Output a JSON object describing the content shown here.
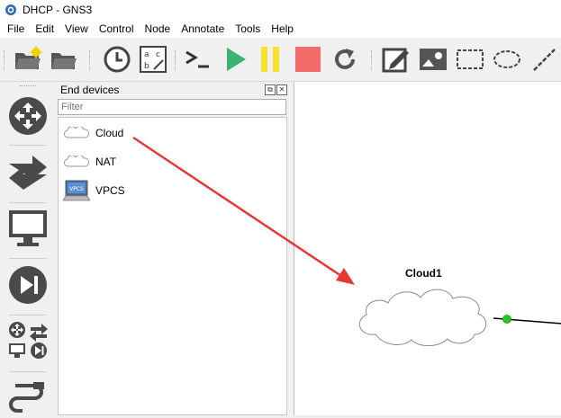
{
  "window": {
    "title": "DHCP - GNS3"
  },
  "menu": [
    "File",
    "Edit",
    "View",
    "Control",
    "Node",
    "Annotate",
    "Tools",
    "Help"
  ],
  "toolbar": {
    "icons": [
      "new-project-icon",
      "open-project-icon",
      "snapshot-icon",
      "device-labels-icon",
      "console-icon",
      "start-icon",
      "suspend-icon",
      "stop-icon",
      "reload-icon",
      "add-note-icon",
      "insert-image-icon",
      "draw-rectangle-icon",
      "draw-ellipse-icon",
      "draw-line-icon"
    ],
    "colors": {
      "start": "#3cb371",
      "suspend": "#f5e22a",
      "stop": "#f36a6a"
    }
  },
  "left_toolbar": [
    "routers-icon",
    "switches-icon",
    "end-devices-icon",
    "security-devices-icon",
    "all-devices-icon",
    "add-link-icon"
  ],
  "dock": {
    "title": "End devices",
    "filter_placeholder": "Filter",
    "devices": [
      {
        "label": "Cloud",
        "icon": "cloud-icon"
      },
      {
        "label": "NAT",
        "icon": "cloud-icon"
      },
      {
        "label": "VPCS",
        "icon": "vpcs-icon",
        "badge": "VPCS"
      }
    ]
  },
  "canvas": {
    "node": {
      "label": "Cloud1",
      "icon": "cloud-icon"
    },
    "link_status_color": "#22cc22",
    "annotation_color": "#e53935"
  }
}
